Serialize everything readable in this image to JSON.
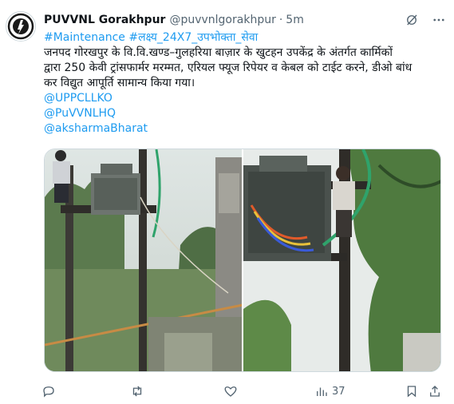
{
  "author": {
    "name": "PUVVNL Gorakhpur",
    "handle": "@puvvnlgorakhpur",
    "separator": "·",
    "time": "5m"
  },
  "tweet": {
    "hashtags": [
      "#Maintenance",
      "#लक्ष्य_24X7_उपभोक्ता_सेवा"
    ],
    "text_lines": [
      "जनपद गोरखपुर के वि.वि.खण्ड–गुलहरिया बाज़ार के खुटहन उपकेंद्र के अंतर्गत कार्मिकों",
      "द्वारा 250 केवी ट्रांसफार्मर मरम्मत, एरियल फ्यूज रिपेयर व केबल को टाईट करने, डीओ बांध",
      "कर विद्युत आपूर्ति सामान्य किया गया।"
    ],
    "mentions": [
      "@UPPCLLKO",
      "@PuVVNLHQ",
      "@aksharmaBharat"
    ]
  },
  "actions": {
    "views": "37"
  },
  "icons": {
    "header": [
      "grok-icon",
      "more-icon"
    ],
    "actions": [
      "reply-icon",
      "retweet-icon",
      "like-icon",
      "views-icon",
      "bookmark-icon",
      "share-icon"
    ]
  },
  "colors": {
    "link": "#1d9bf0",
    "text": "#0f1419",
    "muted": "#536471"
  }
}
